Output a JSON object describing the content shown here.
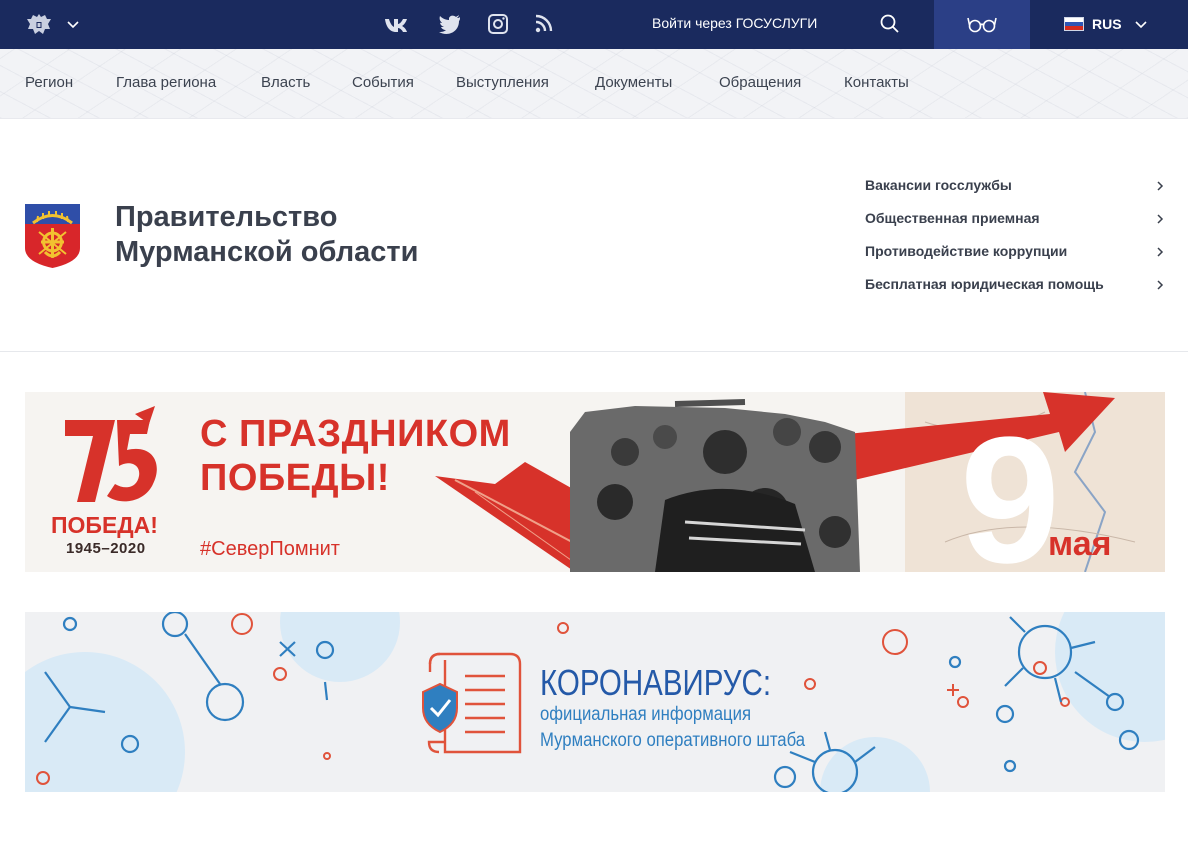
{
  "header": {
    "gosuslugi_label": "Войти через ГОСУСЛУГИ",
    "language": "RUS",
    "social_icons": [
      "vk-icon",
      "twitter-icon",
      "instagram-icon",
      "rss-icon"
    ],
    "colors": {
      "bar": "#1a2a5e",
      "vision_button": "#2b3f86"
    }
  },
  "nav": {
    "items": [
      "Регион",
      "Глава региона",
      "Власть",
      "События",
      "Выступления",
      "Документы",
      "Обращения",
      "Контакты"
    ]
  },
  "brand": {
    "title_line1": "Правительство",
    "title_line2": "Мурманской области"
  },
  "quick_links": [
    "Вакансии госслужбы",
    "Общественная приемная",
    "Противодействие коррупции",
    "Бесплатная юридическая помощь"
  ],
  "banners": {
    "victory": {
      "logo_number": "75",
      "headline_line1": "С ПРАЗДНИКОМ",
      "headline_line2": "ПОБЕДЫ!",
      "logo_word": "ПОБЕДА!",
      "years": "1945–2020",
      "hashtag": "#СеверПомнит",
      "day": "9",
      "month": "мая",
      "accent_color": "#d7322a"
    },
    "covid": {
      "title": "КОРОНАВИРУС:",
      "subtitle_line1": "официальная информация",
      "subtitle_line2": "Мурманского оперативного штаба",
      "accent_color": "#2459a8"
    }
  }
}
